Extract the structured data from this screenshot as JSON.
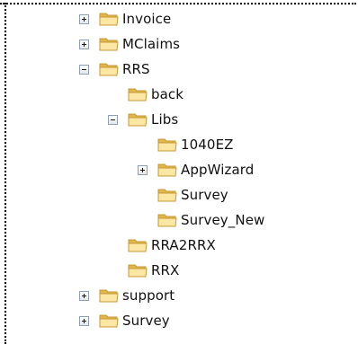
{
  "tree": {
    "items": [
      {
        "label": "Invoice",
        "state": "collapsed",
        "depth": 0
      },
      {
        "label": "MClaims",
        "state": "collapsed",
        "depth": 0
      },
      {
        "label": "RRS",
        "state": "expanded",
        "depth": 0
      },
      {
        "label": "back",
        "state": "leaf",
        "depth": 1
      },
      {
        "label": "Libs",
        "state": "expanded",
        "depth": 1
      },
      {
        "label": "1040EZ",
        "state": "leaf",
        "depth": 2
      },
      {
        "label": "AppWizard",
        "state": "collapsed",
        "depth": 2
      },
      {
        "label": "Survey",
        "state": "leaf",
        "depth": 2
      },
      {
        "label": "Survey_New",
        "state": "leaf",
        "depth": 2
      },
      {
        "label": "RRA2RRX",
        "state": "leaf",
        "depth": 1
      },
      {
        "label": "RRX",
        "state": "leaf",
        "depth": 1
      },
      {
        "label": "support",
        "state": "collapsed",
        "depth": 0
      },
      {
        "label": "Survey",
        "state": "collapsed",
        "depth": 0
      }
    ]
  },
  "colors": {
    "folder_light": "#fbe6a3",
    "folder_dark": "#e3b54b",
    "folder_outline": "#c59a35",
    "expander_border": "#8e9eb3"
  }
}
